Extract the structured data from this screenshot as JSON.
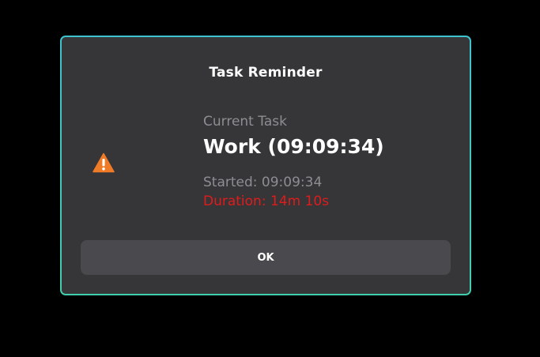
{
  "dialog": {
    "title": "Task Reminder",
    "current_task_label": "Current Task",
    "task_name": "Work (09:09:34)",
    "started": "Started: 09:09:34",
    "duration": "Duration: 14m 10s",
    "ok_label": "OK",
    "icon": "warning-icon",
    "colors": {
      "border_accent": "#3fcfae",
      "background": "#363639",
      "warning": "#f07b27",
      "duration_text": "#e01b1b",
      "button": "#4a4a4e"
    }
  }
}
